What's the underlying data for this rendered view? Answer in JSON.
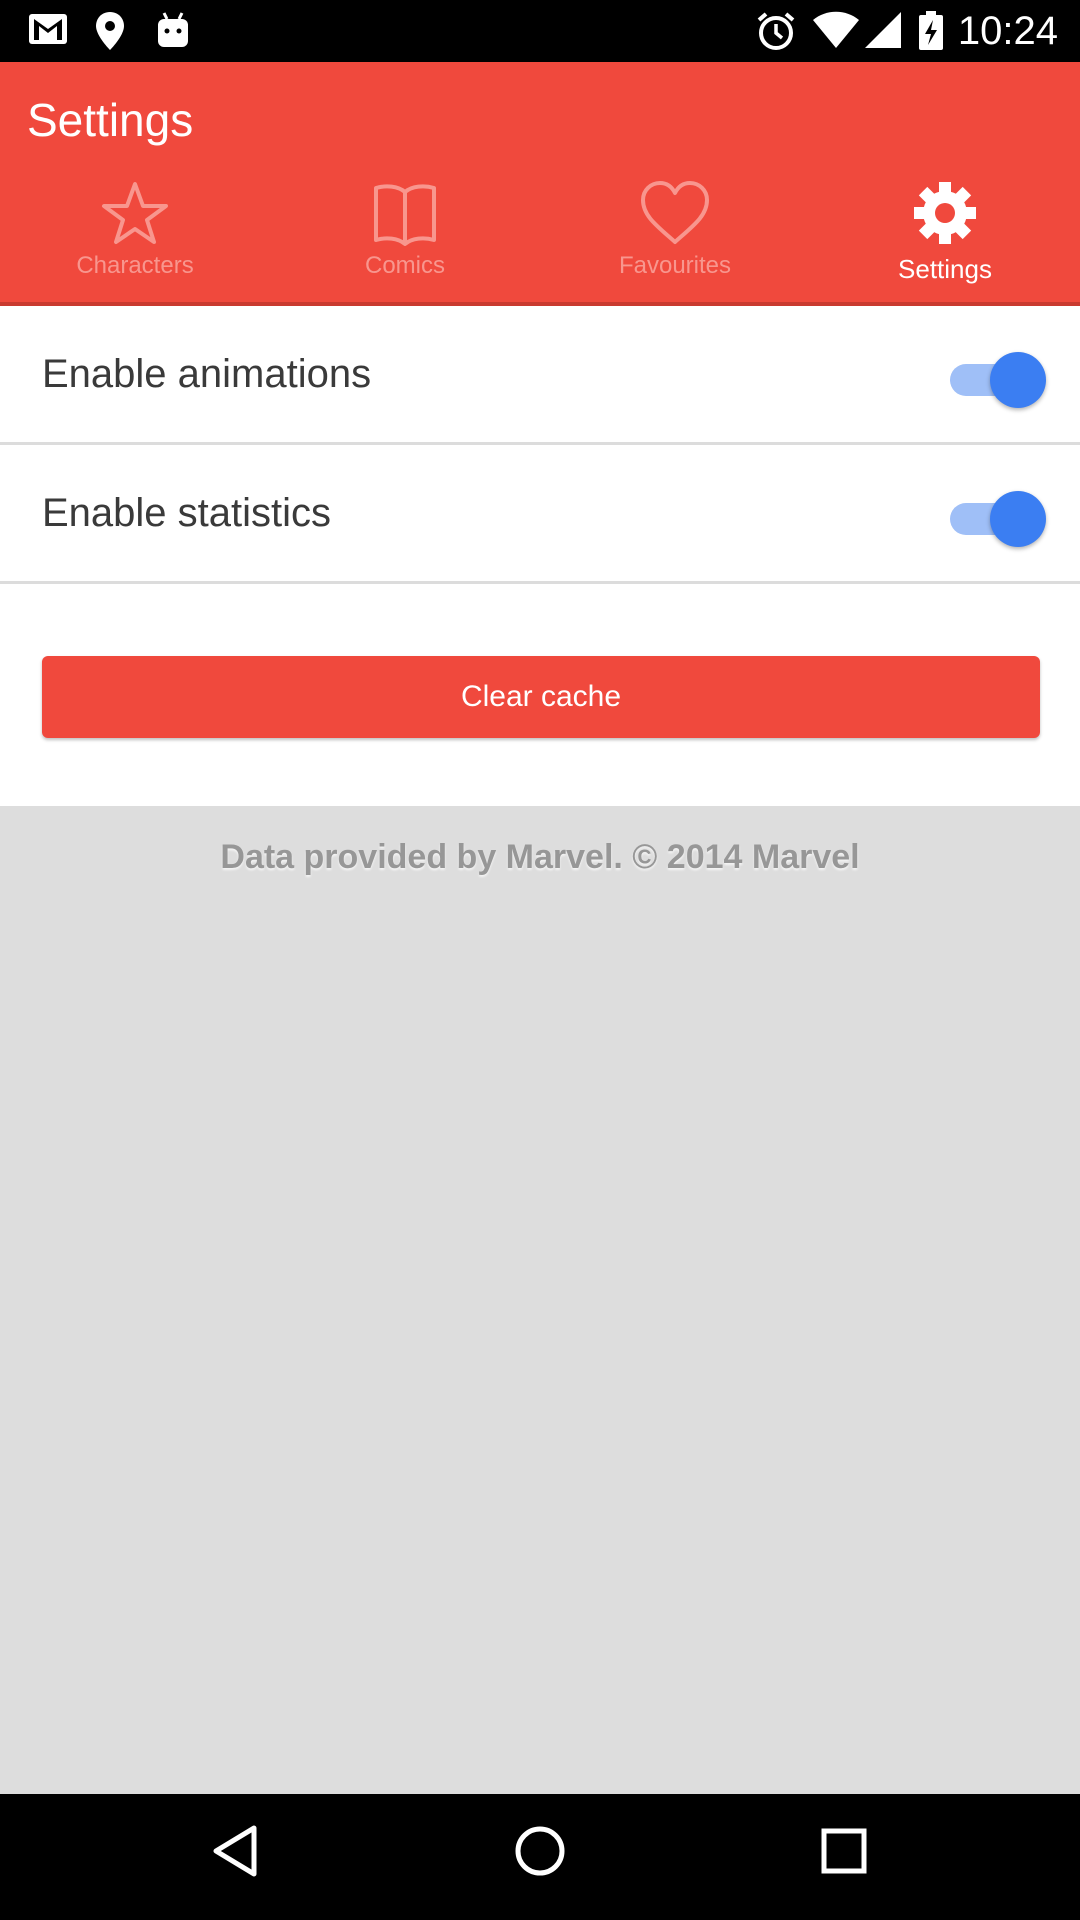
{
  "status_bar": {
    "time": "10:24",
    "left_icons": [
      "gmail-icon",
      "location-pin-icon",
      "android-icon"
    ],
    "right_icons": [
      "alarm-icon",
      "wifi-icon",
      "signal-icon",
      "battery-charging-icon"
    ]
  },
  "app_bar": {
    "title": "Settings",
    "color": "#f0493d",
    "tabs": [
      {
        "label": "Characters",
        "icon": "star-icon",
        "active": false
      },
      {
        "label": "Comics",
        "icon": "book-icon",
        "active": false
      },
      {
        "label": "Favourites",
        "icon": "heart-icon",
        "active": false
      },
      {
        "label": "Settings",
        "icon": "gear-icon",
        "active": true
      }
    ]
  },
  "settings": {
    "items": [
      {
        "label": "Enable animations",
        "enabled": true
      },
      {
        "label": "Enable statistics",
        "enabled": true
      }
    ],
    "clear_cache_label": "Clear cache",
    "toggle_color": "#3b7ef2"
  },
  "footer": {
    "attribution": "Data provided by Marvel. © 2014 Marvel"
  },
  "nav_bar": {
    "buttons": [
      "back-icon",
      "home-icon",
      "recents-icon"
    ]
  }
}
